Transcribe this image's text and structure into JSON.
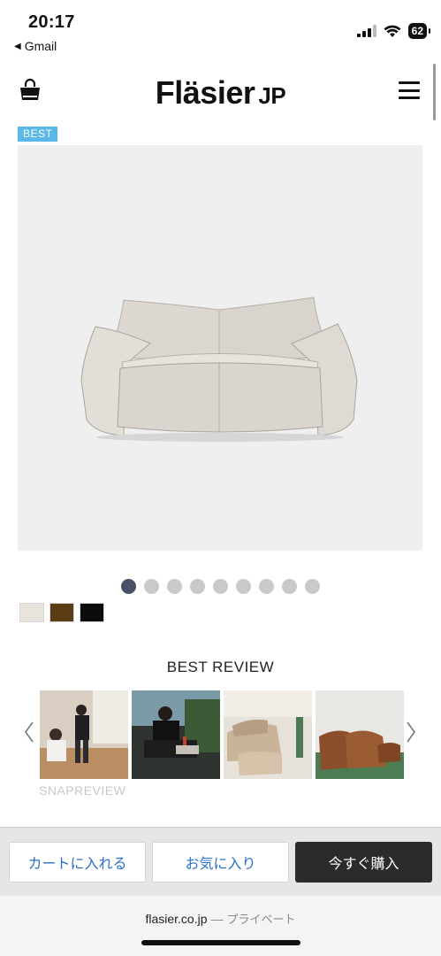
{
  "status": {
    "time": "20:17",
    "back_app": "Gmail",
    "battery": "62"
  },
  "header": {
    "logo": "Fläsier",
    "logo_suffix": "JP"
  },
  "product": {
    "badge": "BEST",
    "dots_total": 9,
    "dots_active_index": 0,
    "swatches": [
      "#e8e4dd",
      "#5a3d14",
      "#0c0c0c"
    ]
  },
  "review": {
    "title": "BEST REVIEW",
    "snap_label": "SNAPREVIEW"
  },
  "actions": {
    "cart_label": "カートに入れる",
    "favorite_label": "お気に入り",
    "buy_label": "今すぐ購入"
  },
  "browser": {
    "domain": "flasier.co.jp",
    "separator": "—",
    "mode": "プライベート"
  },
  "colors": {
    "badge": "#5ab8e8",
    "link_blue": "#2a6fc9",
    "buy_bg": "#2b2b2b",
    "dot_active": "#4a5068",
    "dot_inactive": "#c9c9c9"
  }
}
